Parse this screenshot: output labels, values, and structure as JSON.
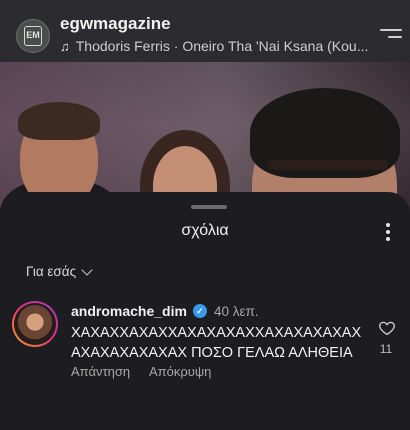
{
  "header": {
    "account_name": "egwmagazine",
    "account_logo_text": "EM",
    "track": "Thodoris Ferris · Oneiro Tha 'Nai Ksana (Kou..."
  },
  "sheet": {
    "title": "σχόλια",
    "filter_label": "Για εσάς"
  },
  "comment": {
    "username": "andromache_dim",
    "verified": true,
    "time": "40 λεπ.",
    "text": "ΧΑΧΑΧΧΑΧΑΧΧΑΧΑΧΑΧΑΧΧΑΧΑΧΑΧΑΧΑΧ ΑΧΑΧΑΧΑΧΑΧΑΧ ΠΟΣΟ ΓΕΛΑΩ ΑΛΗΘΕΙΑ",
    "reply_label": "Απάντηση",
    "hide_label": "Απόκρυψη",
    "likes": "11"
  },
  "icons": {
    "music": "music-note-icon",
    "menu": "menu-icon",
    "more": "more-vertical-icon",
    "heart": "heart-icon",
    "verified": "verified-badge-icon",
    "filter": "chevron-down-icon"
  },
  "colors": {
    "sheet_bg": "#1c1c21",
    "verified_blue": "#3897f0",
    "story_ring": "#e1306c"
  }
}
